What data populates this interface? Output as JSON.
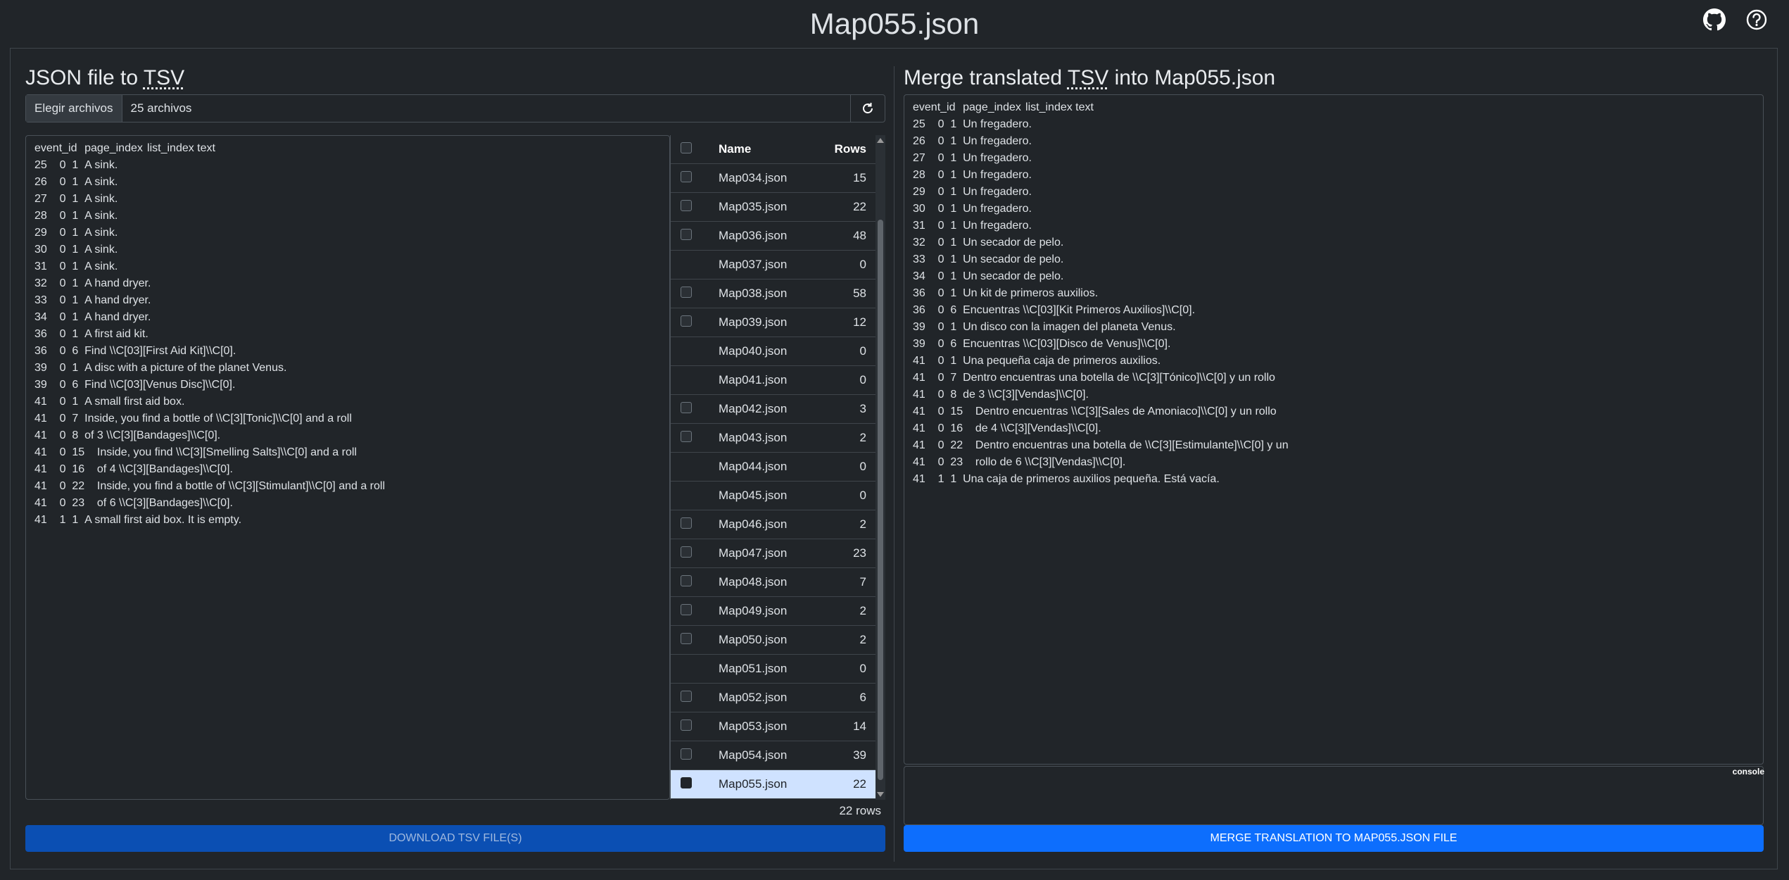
{
  "header": {
    "title": "Map055.json"
  },
  "icons": {
    "github": "github-icon",
    "help": "help-icon"
  },
  "left": {
    "title_prefix": "JSON file to ",
    "title_abbr": "TSV",
    "file_button": "Elegir archivos",
    "file_status": "25 archivos",
    "tsv_text": "event_id\tpage_index\tlist_index\ttext\n25\t0\t1\tA sink.\n26\t0\t1\tA sink.\n27\t0\t1\tA sink.\n28\t0\t1\tA sink.\n29\t0\t1\tA sink.\n30\t0\t1\tA sink.\n31\t0\t1\tA sink.\n32\t0\t1\tA hand dryer.\n33\t0\t1\tA hand dryer.\n34\t0\t1\tA hand dryer.\n36\t0\t1\tA first aid kit.\n36\t0\t6\tFind \\\\C[03][First Aid Kit]\\\\C[0].\n39\t0\t1\tA disc with a picture of the planet Venus.\n39\t0\t6\tFind \\\\C[03][Venus Disc]\\\\C[0].\n41\t0\t1\tA small first aid box.\n41\t0\t7\tInside, you find a bottle of \\\\C[3][Tonic]\\\\C[0] and a roll\n41\t0\t8\tof 3 \\\\C[3][Bandages]\\\\C[0].\n41\t0\t15\tInside, you find \\\\C[3][Smelling Salts]\\\\C[0] and a roll\n41\t0\t16\tof 4 \\\\C[3][Bandages]\\\\C[0].\n41\t0\t22\tInside, you find a bottle of \\\\C[3][Stimulant]\\\\C[0] and a roll\n41\t0\t23\tof 6 \\\\C[3][Bandages]\\\\C[0].\n41\t1\t1\tA small first aid box. It is empty.",
    "table": {
      "headers": {
        "name": "Name",
        "rows": "Rows"
      },
      "files": [
        {
          "name": "Map034.json",
          "rows": "15",
          "checkbox": true,
          "selected": false
        },
        {
          "name": "Map035.json",
          "rows": "22",
          "checkbox": true,
          "selected": false
        },
        {
          "name": "Map036.json",
          "rows": "48",
          "checkbox": true,
          "selected": false
        },
        {
          "name": "Map037.json",
          "rows": "0",
          "checkbox": false,
          "selected": false
        },
        {
          "name": "Map038.json",
          "rows": "58",
          "checkbox": true,
          "selected": false
        },
        {
          "name": "Map039.json",
          "rows": "12",
          "checkbox": true,
          "selected": false
        },
        {
          "name": "Map040.json",
          "rows": "0",
          "checkbox": false,
          "selected": false
        },
        {
          "name": "Map041.json",
          "rows": "0",
          "checkbox": false,
          "selected": false
        },
        {
          "name": "Map042.json",
          "rows": "3",
          "checkbox": true,
          "selected": false
        },
        {
          "name": "Map043.json",
          "rows": "2",
          "checkbox": true,
          "selected": false
        },
        {
          "name": "Map044.json",
          "rows": "0",
          "checkbox": false,
          "selected": false
        },
        {
          "name": "Map045.json",
          "rows": "0",
          "checkbox": false,
          "selected": false
        },
        {
          "name": "Map046.json",
          "rows": "2",
          "checkbox": true,
          "selected": false
        },
        {
          "name": "Map047.json",
          "rows": "23",
          "checkbox": true,
          "selected": false
        },
        {
          "name": "Map048.json",
          "rows": "7",
          "checkbox": true,
          "selected": false
        },
        {
          "name": "Map049.json",
          "rows": "2",
          "checkbox": true,
          "selected": false
        },
        {
          "name": "Map050.json",
          "rows": "2",
          "checkbox": true,
          "selected": false
        },
        {
          "name": "Map051.json",
          "rows": "0",
          "checkbox": false,
          "selected": false
        },
        {
          "name": "Map052.json",
          "rows": "6",
          "checkbox": true,
          "selected": false
        },
        {
          "name": "Map053.json",
          "rows": "14",
          "checkbox": true,
          "selected": false
        },
        {
          "name": "Map054.json",
          "rows": "39",
          "checkbox": true,
          "selected": false
        },
        {
          "name": "Map055.json",
          "rows": "22",
          "checkbox": true,
          "selected": true
        }
      ]
    },
    "row_count": "22 rows",
    "download_button": "DOWNLOAD TSV FILE(s)"
  },
  "right": {
    "title_prefix": "Merge translated ",
    "title_abbr": "TSV",
    "title_suffix": " into Map055.json",
    "tsv_text": "event_id\tpage_index\tlist_index\ttext\n25\t0\t1\tUn fregadero.\n26\t0\t1\tUn fregadero.\n27\t0\t1\tUn fregadero.\n28\t0\t1\tUn fregadero.\n29\t0\t1\tUn fregadero.\n30\t0\t1\tUn fregadero.\n31\t0\t1\tUn fregadero.\n32\t0\t1\tUn secador de pelo.\n33\t0\t1\tUn secador de pelo.\n34\t0\t1\tUn secador de pelo.\n36\t0\t1\tUn kit de primeros auxilios.\n36\t0\t6\tEncuentras \\\\C[03][Kit Primeros Auxilios]\\\\C[0].\n39\t0\t1\tUn disco con la imagen del planeta Venus.\n39\t0\t6\tEncuentras \\\\C[03][Disco de Venus]\\\\C[0].\n41\t0\t1\tUna pequeña caja de primeros auxilios.\n41\t0\t7\tDentro encuentras una botella de \\\\C[3][Tónico]\\\\C[0] y un rollo\n41\t0\t8\tde 3 \\\\C[3][Vendas]\\\\C[0].\n41\t0\t15\tDentro encuentras \\\\C[3][Sales de Amoniaco]\\\\C[0] y un rollo\n41\t0\t16\tde 4 \\\\C[3][Vendas]\\\\C[0].\n41\t0\t22\tDentro encuentras una botella de \\\\C[3][Estimulante]\\\\C[0] y un\n41\t0\t23\trollo de 6 \\\\C[3][Vendas]\\\\C[0].\n41\t1\t1\tUna caja de primeros auxilios pequeña. Está vacía.",
    "console_label": "console",
    "merge_button": "MERGE TRANSLATION TO Map055.json FILE"
  },
  "colors": {
    "background": "#212529",
    "primary": "#0d6efd",
    "primary_muted": "#0b4fb3",
    "selected_row": "#cfe2ff"
  }
}
